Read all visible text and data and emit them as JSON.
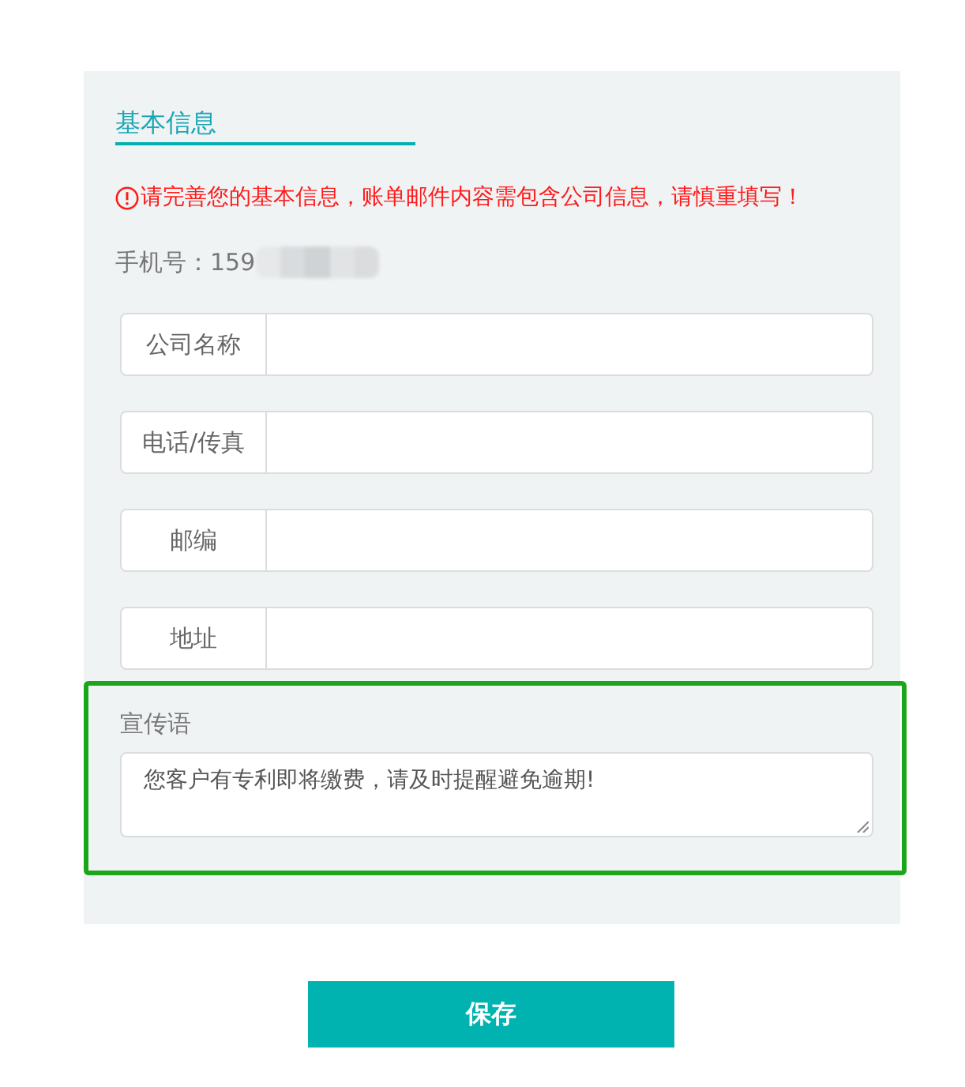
{
  "section": {
    "title": "基本信息"
  },
  "notice": {
    "text": "请完善您的基本信息，账单邮件内容需包含公司信息，请慎重填写！"
  },
  "phone": {
    "text": "手机号：159",
    "redacted": true
  },
  "fields": [
    {
      "label": "公司名称"
    },
    {
      "label": "电话/传真"
    },
    {
      "label": "邮编"
    },
    {
      "label": "地址"
    }
  ],
  "slogan": {
    "label": "宣传语",
    "value": "您客户有专利即将缴费，请及时提醒避免逾期!",
    "highlighted": true
  },
  "buttons": [
    {
      "label": "保存"
    }
  ]
}
